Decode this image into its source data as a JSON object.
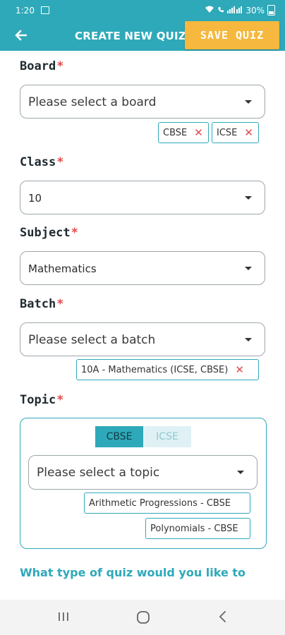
{
  "status": {
    "time": "1:20",
    "battery": "30%"
  },
  "app_bar": {
    "title": "CREATE NEW QUIZ",
    "save_label": "SAVE QUIZ"
  },
  "form": {
    "board": {
      "label": "Board",
      "required_mark": "*",
      "placeholder": "Please select a board",
      "chips": [
        "CBSE",
        "ICSE"
      ]
    },
    "class": {
      "label": "Class",
      "required_mark": "*",
      "value": "10"
    },
    "subject": {
      "label": "Subject",
      "required_mark": "*",
      "value": "Mathematics"
    },
    "batch": {
      "label": "Batch",
      "required_mark": "*",
      "placeholder": "Please select a batch",
      "chips": [
        "10A - Mathematics (ICSE, CBSE)"
      ]
    },
    "topic": {
      "label": "Topic",
      "required_mark": "*",
      "tabs": [
        "CBSE",
        "ICSE"
      ],
      "active_tab": "CBSE",
      "placeholder": "Please select a topic",
      "chips": [
        "Arithmetic Progressions - CBSE",
        "Polynomials - CBSE"
      ]
    },
    "quiz_type_question": "What type of quiz would you like to"
  },
  "icons": {
    "back": "arrow-left-icon",
    "dropdown": "caret-down-icon",
    "remove_chip": "close-icon",
    "nav_recents": "recents-icon",
    "nav_home": "home-icon",
    "nav_back": "chevron-left-icon"
  },
  "colors": {
    "primary": "#2ea9b9",
    "accent": "#f6b83e",
    "required": "#e24b4b"
  }
}
